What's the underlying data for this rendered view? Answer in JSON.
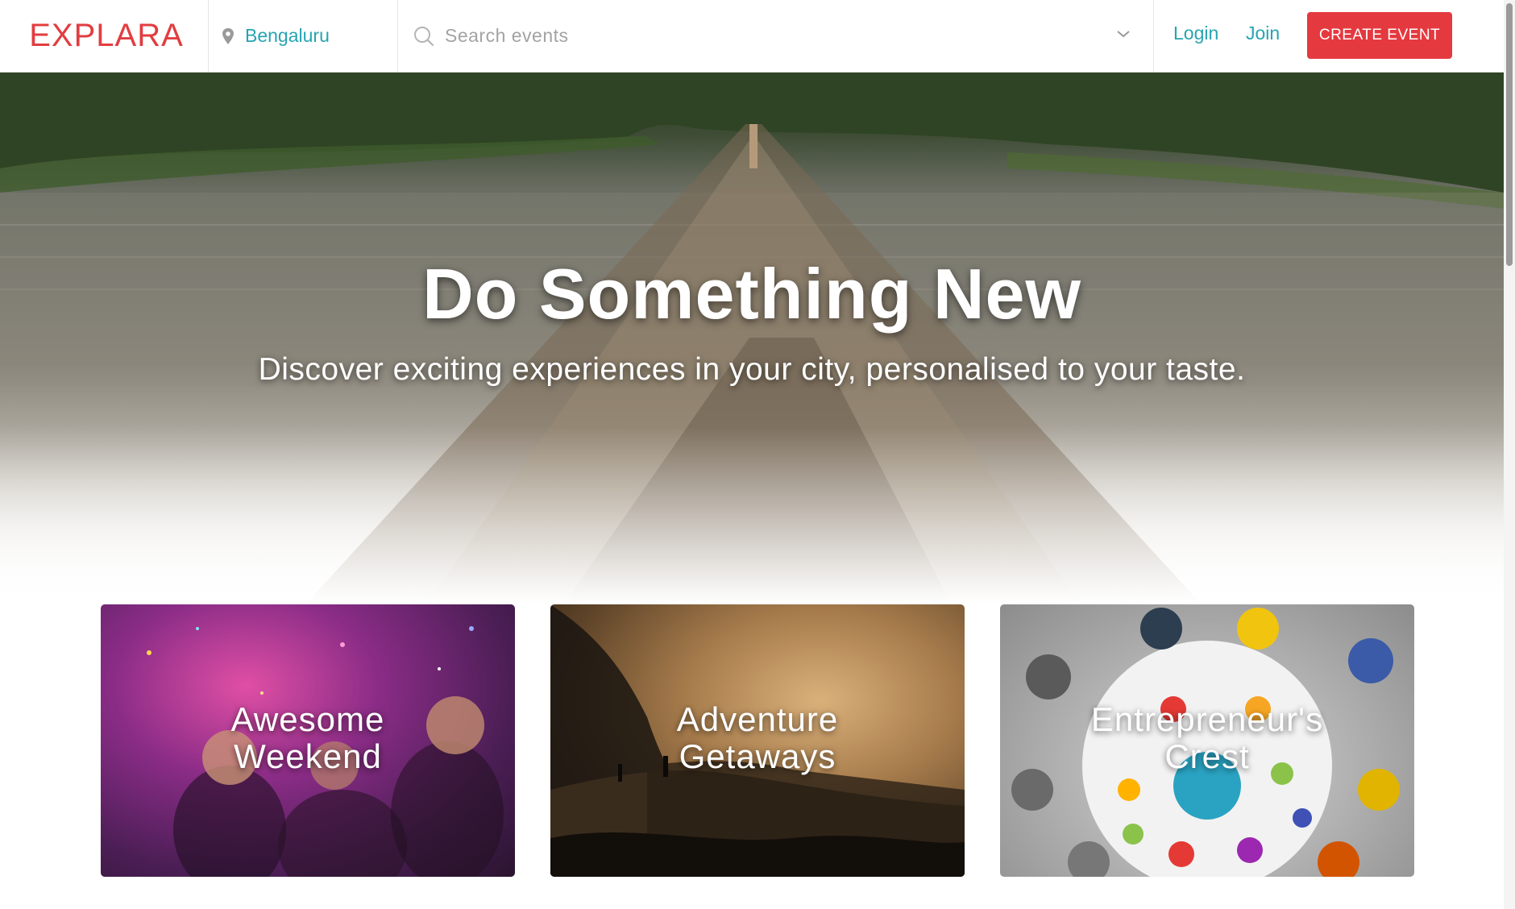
{
  "header": {
    "logo_text": "EXPLARA",
    "location": "Bengaluru",
    "search_placeholder": "Search events",
    "login_label": "Login",
    "join_label": "Join",
    "create_event_label": "CREATE EVENT"
  },
  "hero": {
    "title": "Do Something New",
    "subtitle": "Discover exciting experiences in your city, personalised to your taste."
  },
  "cards": [
    {
      "line1": "Awesome",
      "line2": "Weekend"
    },
    {
      "line1": "Adventure",
      "line2": "Getaways"
    },
    {
      "line1": "Entrepreneur's",
      "line2": "Crest"
    }
  ],
  "colors": {
    "brand_red": "#e4393f",
    "link_teal": "#27a4b2"
  },
  "icons": [
    "location-pin-icon",
    "search-icon",
    "chevron-down-icon"
  ]
}
